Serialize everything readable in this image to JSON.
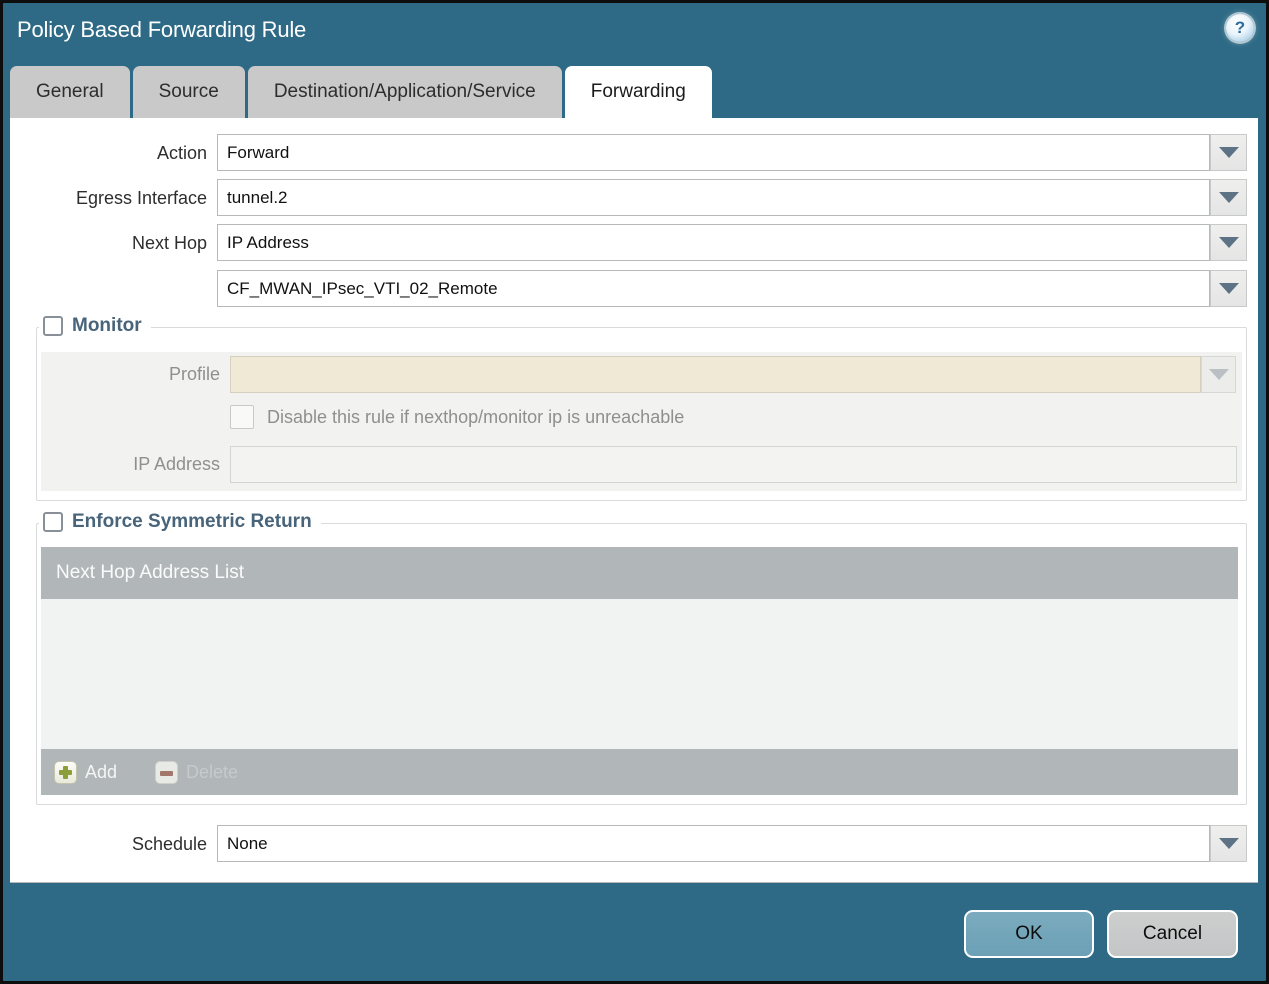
{
  "window": {
    "title": "Policy Based Forwarding Rule"
  },
  "icons": {
    "help_glyph": "?"
  },
  "tabs": [
    {
      "label": "General",
      "active": false
    },
    {
      "label": "Source",
      "active": false
    },
    {
      "label": "Destination/Application/Service",
      "active": false
    },
    {
      "label": "Forwarding",
      "active": true
    }
  ],
  "form": {
    "action_label": "Action",
    "action_value": "Forward",
    "egress_label": "Egress Interface",
    "egress_value": "tunnel.2",
    "next_hop_label": "Next Hop",
    "next_hop_value": "IP Address",
    "next_hop_address_value": "CF_MWAN_IPsec_VTI_02_Remote",
    "schedule_label": "Schedule",
    "schedule_value": "None"
  },
  "monitor": {
    "title": "Monitor",
    "checked": false,
    "profile_label": "Profile",
    "profile_value": "",
    "disable_rule_label": "Disable this rule if nexthop/monitor ip is unreachable",
    "disable_rule_checked": false,
    "ip_address_label": "IP Address",
    "ip_address_value": ""
  },
  "symmetric_return": {
    "title": "Enforce Symmetric Return",
    "checked": false,
    "list_header": "Next Hop Address List",
    "rows": [],
    "add_label": "Add",
    "delete_label": "Delete"
  },
  "buttons": {
    "ok": "OK",
    "cancel": "Cancel"
  },
  "colors": {
    "titlebar": "#2e6a86",
    "active_tab": "#ffffff",
    "inactive_tab": "#c9c9c9",
    "disabled_field_beige": "#f0e9d6",
    "table_bar_gray": "#b1b6b9",
    "ok_button": "#73a6bb",
    "cancel_button": "#c8caca",
    "section_title": "#47647a",
    "add_plus_green": "#8b9e3a",
    "delete_minus_red": "#a4776d"
  }
}
